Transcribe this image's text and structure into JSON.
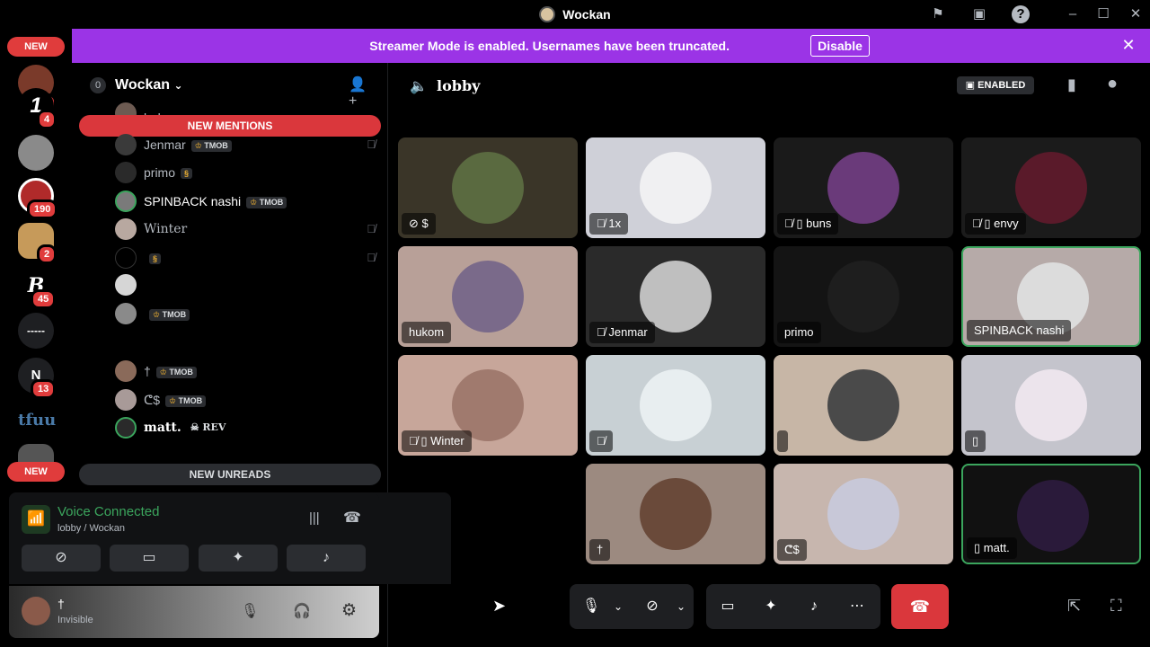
{
  "window": {
    "title": "Wockan",
    "icons": {
      "flag": "flag-icon",
      "inbox": "inbox-icon",
      "help": "help-icon"
    }
  },
  "rail": {
    "new_top": "NEW",
    "new_bottom": "NEW",
    "servers": [
      {
        "name": "server-1",
        "badge": "4",
        "letter": ""
      },
      {
        "name": "server-2",
        "badge": "4",
        "letter": "1"
      },
      {
        "name": "server-3",
        "badge": "",
        "letter": ""
      },
      {
        "name": "server-4",
        "badge": "190",
        "letter": ""
      },
      {
        "name": "server-5",
        "badge": "2",
        "letter": ""
      },
      {
        "name": "server-6",
        "badge": "45",
        "letter": "B"
      },
      {
        "name": "server-7",
        "badge": "",
        "letter": "-----"
      },
      {
        "name": "server-8",
        "badge": "13",
        "letter": "N"
      },
      {
        "name": "server-9",
        "badge": "",
        "letter": "tfuu"
      }
    ]
  },
  "banner": {
    "message": "Streamer Mode is enabled. Usernames have been truncated.",
    "button": "Disable"
  },
  "sidebar": {
    "server_name": "Wockan",
    "server_icon_label": "0",
    "new_mentions": "NEW MENTIONS",
    "new_unreads": "NEW UNREADS",
    "members": [
      {
        "name": "hukom",
        "tag": "",
        "muted": false
      },
      {
        "name": "Jenmar",
        "tag": "TMOB",
        "muted": true
      },
      {
        "name": "primo",
        "tag": "§",
        "muted": false
      },
      {
        "name": "SPINBACK nashi",
        "tag": "TMOB",
        "muted": false
      },
      {
        "name": "Winter",
        "tag": "",
        "muted": true
      },
      {
        "name": "",
        "tag": "§",
        "muted": true
      },
      {
        "name": "",
        "tag": "",
        "muted": false
      },
      {
        "name": "",
        "tag": "TMOB",
        "muted": false
      },
      {
        "name": "†",
        "tag": "TMOB",
        "muted": false
      },
      {
        "name": "ᕦ$",
        "tag": "TMOB",
        "muted": false
      },
      {
        "name": "matt.",
        "tag": "REV",
        "muted": false
      }
    ]
  },
  "voice": {
    "status": "Voice Connected",
    "channel": "lobby / Wockan"
  },
  "user": {
    "name": "†",
    "status": "Invisible"
  },
  "channel": {
    "name": "lobby",
    "enabled_label": "ENABLED"
  },
  "tiles": [
    {
      "label": "$",
      "icons": "video-off",
      "bg": "#3a3528",
      "ring": "#5a6a40"
    },
    {
      "label": "1x",
      "icons": "mic-off",
      "bg": "#cfd0d8",
      "ring": "#f0f0f2"
    },
    {
      "label": "buns",
      "icons": "mic-off phone",
      "bg": "#1a1a1a",
      "ring": "#6a3a7a"
    },
    {
      "label": "envy",
      "icons": "mic-off phone",
      "bg": "#1b1b1b",
      "ring": "#5a1a2a"
    },
    {
      "label": "hukom",
      "icons": "",
      "bg": "#b8a098",
      "ring": "#7a6a8a"
    },
    {
      "label": "Jenmar",
      "icons": "mic-off",
      "bg": "#2a2a2a",
      "ring": "#bfbfbf"
    },
    {
      "label": "primo",
      "icons": "",
      "bg": "#141414",
      "ring": "#1e1e1e"
    },
    {
      "label": "SPINBACK nashi",
      "icons": "",
      "bg": "#b6aaa8",
      "ring": "#dcdcdc"
    },
    {
      "label": "Winter",
      "icons": "mic-off phone",
      "bg": "#c7a69a",
      "ring": "#a07a6e"
    },
    {
      "label": "",
      "icons": "mic-off",
      "bg": "#c8d0d4",
      "ring": "#e8eef0"
    },
    {
      "label": "",
      "icons": "",
      "bg": "#c7b6a6",
      "ring": "#4a4a4a"
    },
    {
      "label": "",
      "icons": "phone",
      "bg": "#c4c4cc",
      "ring": "#ece4ec"
    },
    {
      "label": "†",
      "icons": "",
      "bg": "#9c8a80",
      "ring": "#6a4a3a"
    },
    {
      "label": "ᕦ$",
      "icons": "",
      "bg": "#c7b6ae",
      "ring": "#c8c8d8"
    },
    {
      "label": "matt.",
      "icons": "phone",
      "bg": "#111",
      "ring": "#2a1a3a"
    }
  ]
}
